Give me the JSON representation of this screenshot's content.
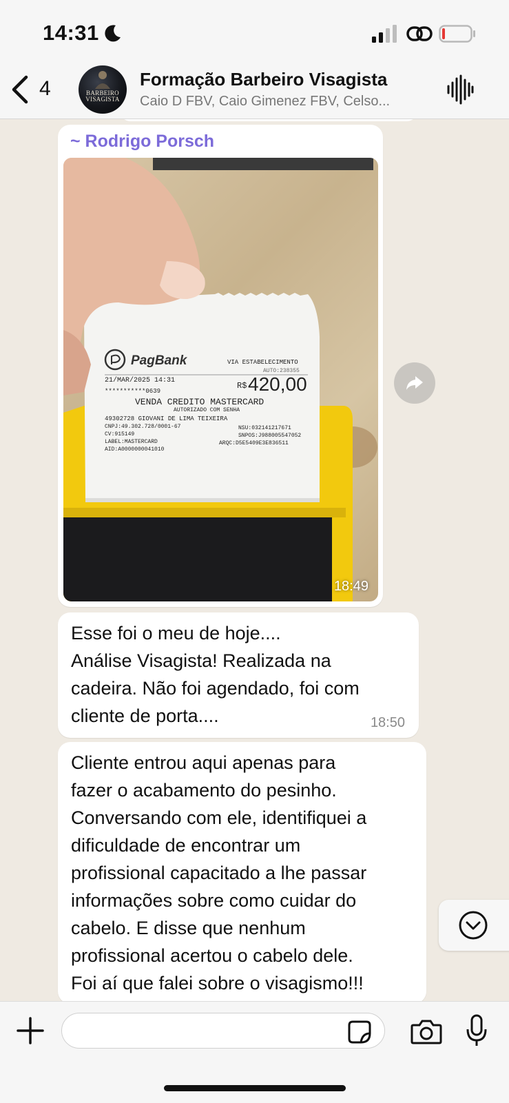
{
  "status_bar": {
    "time": "14:31",
    "icons": [
      "moon-icon",
      "signal-icon",
      "link-icon",
      "battery-icon"
    ],
    "battery_color": "#e53935"
  },
  "header": {
    "back_count": "4",
    "title": "Formação Barbeiro Visagista",
    "members": "Caio D FBV, Caio Gimenez FBV, Celso...",
    "avatar_text": "BARBEIRO VISAGISTA"
  },
  "messages": [
    {
      "type": "image",
      "sender": "~ Rodrigo Porsch",
      "sender_color": "#7c6bd9",
      "time": "18:49",
      "receipt": {
        "brand": "PagBank",
        "via": "VIA ESTABELECIMENTO",
        "auto": "AUTO:238355",
        "date": "21/MAR/2025 14:31",
        "card": "***********0639",
        "amount": "420,00",
        "currency": "R$",
        "sale_type": "VENDA CREDITO MASTERCARD",
        "auth": "AUTORIZADO COM SENHA",
        "merchant": "49302728 GIOVANI DE LIMA TEIXEIRA",
        "cnpj": "CNPJ:49.302.728/0001-67",
        "cv": "CV:915149",
        "label": "LABEL:MASTERCARD",
        "aid": "AID:A0000000041010",
        "nsu": "NSU:032141217671",
        "snpos": "SNPOS:J988005547052",
        "arqc": "ARQC:D5E5409E3E836511"
      }
    },
    {
      "type": "text",
      "text": "Esse foi o meu de hoje....\nAnálise Visagista! Realizada na cadeira. Não foi agendado, foi com cliente de porta....",
      "lines": [
        "Esse foi o meu de hoje....",
        "Análise Visagista! Realizada na",
        "cadeira. Não foi agendado, foi com",
        "cliente de porta...."
      ],
      "time": "18:50"
    },
    {
      "type": "text",
      "lines": [
        "Cliente entrou aqui apenas para",
        "fazer o acabamento do pesinho.",
        "Conversando com ele, identifiquei a",
        "dificuldade de encontrar um",
        "profissional capacitado a lhe passar",
        "informações sobre como cuidar do",
        "cabelo. E disse que nenhum",
        "profissional acertou o cabelo dele.",
        "Foi aí que falei sobre o visagismo!!!"
      ]
    }
  ],
  "composer": {
    "placeholder": "",
    "icons": [
      "plus-icon",
      "sticker-icon",
      "camera-icon",
      "mic-icon"
    ]
  }
}
